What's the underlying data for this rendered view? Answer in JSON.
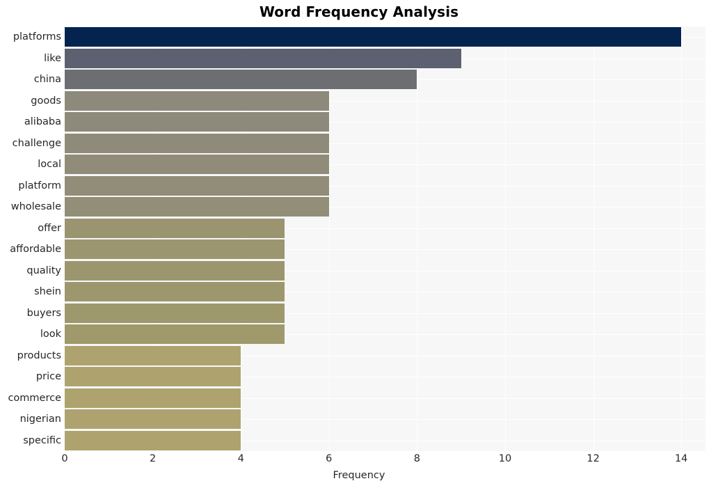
{
  "chart_data": {
    "type": "bar",
    "orientation": "horizontal",
    "title": "Word Frequency Analysis",
    "xlabel": "Frequency",
    "ylabel": "",
    "xlim": [
      0,
      14.55
    ],
    "xticks": [
      0,
      2,
      4,
      6,
      8,
      10,
      12,
      14
    ],
    "xtick_labels": [
      "0",
      "2",
      "4",
      "6",
      "8",
      "10",
      "12",
      "14"
    ],
    "grid": true,
    "legend": false,
    "categories": [
      "platforms",
      "like",
      "china",
      "goods",
      "alibaba",
      "challenge",
      "local",
      "platform",
      "wholesale",
      "offer",
      "affordable",
      "quality",
      "shein",
      "buyers",
      "look",
      "products",
      "price",
      "commerce",
      "nigerian",
      "specific"
    ],
    "values": [
      14,
      9,
      8,
      6,
      6,
      6,
      6,
      6,
      6,
      5,
      5,
      5,
      5,
      5,
      5,
      4,
      4,
      4,
      4,
      4
    ],
    "colors": [
      "#04234f",
      "#5c6070",
      "#6d6e72",
      "#8d8a7c",
      "#8e8a7b",
      "#8f8b7a",
      "#908c79",
      "#918d78",
      "#928e77",
      "#9a9471",
      "#9b9570",
      "#9c966f",
      "#9d976e",
      "#9e986d",
      "#9f996c",
      "#aea36f",
      "#aea36f",
      "#aea36f",
      "#aea36f",
      "#aea36f"
    ],
    "plot_background": "#f7f7f7",
    "grid_color": "#ffffff",
    "figure_background": "#ffffff",
    "text_color": "#262626"
  }
}
